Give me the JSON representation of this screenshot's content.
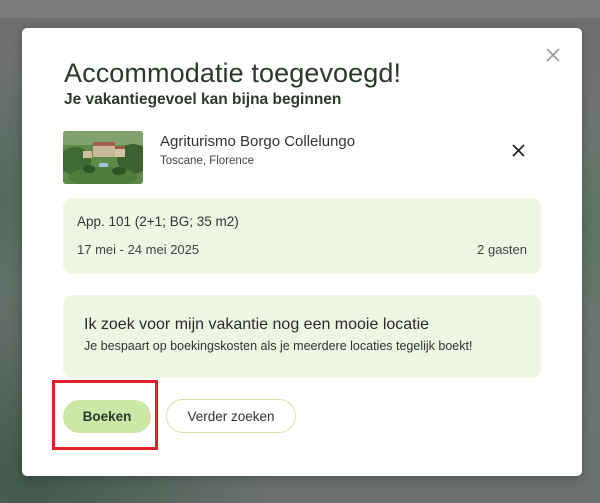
{
  "modal": {
    "title": "Accommodatie toegevoegd!",
    "subtitle": "Je vakantiegevoel kan bijna beginnen",
    "close_icon": "close-icon"
  },
  "accommodation": {
    "name": "Agriturismo Borgo Collelungo",
    "location": "Toscane, Florence",
    "thumbnail_icon": "accommodation-photo",
    "remove_icon": "close-icon"
  },
  "booking": {
    "unit": "App. 101 (2+1; BG; 35 m2)",
    "dates": "17 mei - 24 mei 2025",
    "guests": "2 gasten"
  },
  "promo": {
    "title": "Ik zoek voor mijn vakantie nog een mooie locatie",
    "text": "Je bespaart op boekingskosten als je meerdere locaties tegelijk boekt!"
  },
  "actions": {
    "primary_label": "Boeken",
    "secondary_label": "Verder zoeken"
  },
  "colors": {
    "accent": "#cde8a6",
    "card_background": "#eef5e3",
    "highlight": "#e0202a",
    "text_dark": "#2b3a2a"
  }
}
